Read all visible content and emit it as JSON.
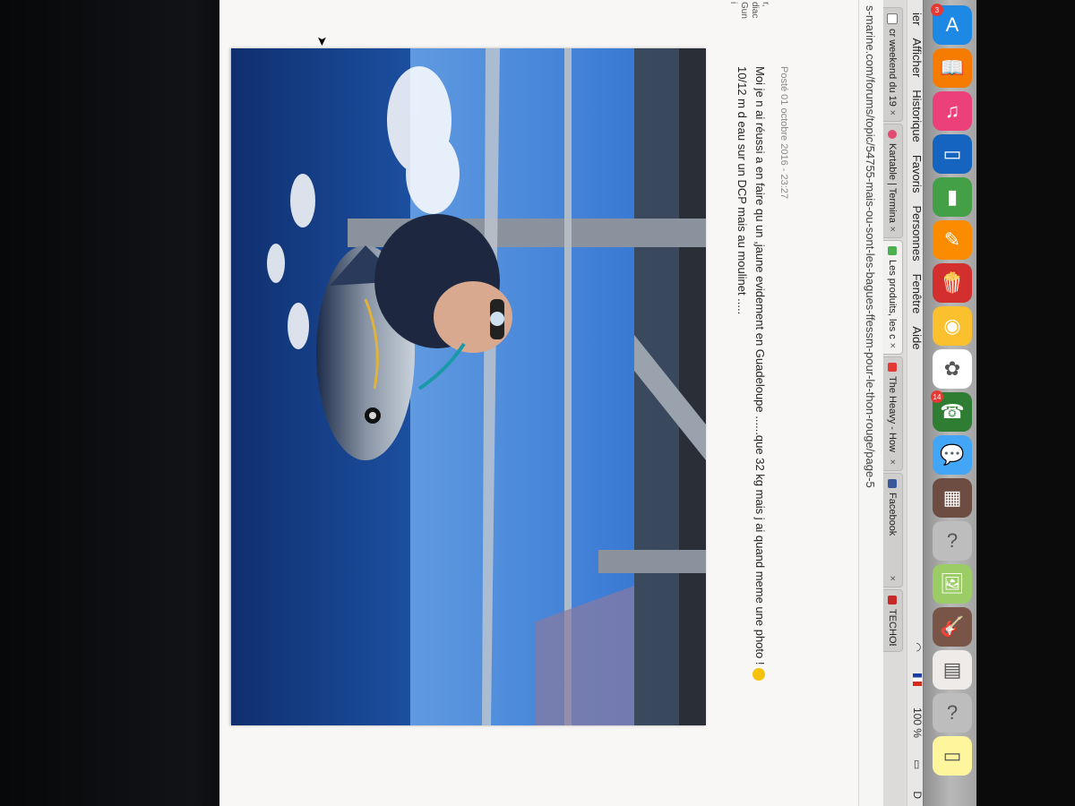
{
  "menu": {
    "items": [
      "ier",
      "Afficher",
      "Historique",
      "Favoris",
      "Personnes",
      "Fenêtre",
      "Aide"
    ],
    "status": {
      "zoom": "100 %",
      "right_label": "D"
    }
  },
  "tabs": [
    {
      "label": "cr weekend du 19",
      "color": "#ffffff"
    },
    {
      "label": "Kartable | Termina",
      "color": "#e34a6f"
    },
    {
      "label": "Les produits, les c",
      "color": "#4caf50"
    },
    {
      "label": "The Heavy - How",
      "color": "#e53935"
    },
    {
      "label": "Facebook",
      "color": "#3b5998"
    }
  ],
  "extra_tab": "TECHOBL",
  "address": {
    "url": "s-marine.com/forums/topic/54755-mais-ou-sont-les-bagues-ffessm-pour-le-thon-rouge/page-5"
  },
  "sidebar_fragment": {
    "lines": [
      "r,",
      "diac",
      "Gun",
      "i"
    ]
  },
  "post": {
    "date": "Posté 01 octobre 2016 - 23:27",
    "line1": "Moi je n ai réussi a en faire qu un ,jaune evidement en Guadeloupe ......que 32 kg mais j ai quand meme une photo !",
    "line2": "10/12 m d eau sur un DCP mais au moulinet ....."
  },
  "dock": {
    "items": [
      {
        "name": "app-store-icon",
        "color": "#1e88e5",
        "glyph": "A",
        "badge": "3"
      },
      {
        "name": "ibooks-icon",
        "color": "#f57c00",
        "glyph": "📖"
      },
      {
        "name": "itunes-icon",
        "color": "#ec407a",
        "glyph": "♫"
      },
      {
        "name": "keynote-icon",
        "color": "#1565c0",
        "glyph": "▭"
      },
      {
        "name": "numbers-icon",
        "color": "#43a047",
        "glyph": "▮"
      },
      {
        "name": "pages-icon",
        "color": "#fb8c00",
        "glyph": "✎"
      },
      {
        "name": "popcorn-icon",
        "color": "#d32f2f",
        "glyph": "🍿"
      },
      {
        "name": "chrome-icon",
        "color": "#fbc02d",
        "glyph": "◉"
      },
      {
        "name": "photos-icon",
        "color": "#ffffff",
        "glyph": "✿"
      },
      {
        "name": "facetime-icon",
        "color": "#2e7d32",
        "glyph": "☎",
        "badge": "14"
      },
      {
        "name": "messages-icon",
        "color": "#42a5f5",
        "glyph": "💬"
      },
      {
        "name": "photo-booth-icon",
        "color": "#6d4c41",
        "glyph": "▦"
      },
      {
        "name": "help-icon",
        "color": "#bdbdbd",
        "glyph": "?"
      },
      {
        "name": "preview-icon",
        "color": "#9ccc65",
        "glyph": "🖼"
      },
      {
        "name": "garageband-icon",
        "color": "#795548",
        "glyph": "🎸"
      },
      {
        "name": "calendar-icon",
        "color": "#efebe9",
        "glyph": "▤"
      },
      {
        "name": "help-icon",
        "color": "#bdbdbd",
        "glyph": "?"
      },
      {
        "name": "notes-icon",
        "color": "#fff59d",
        "glyph": "▭"
      }
    ]
  }
}
